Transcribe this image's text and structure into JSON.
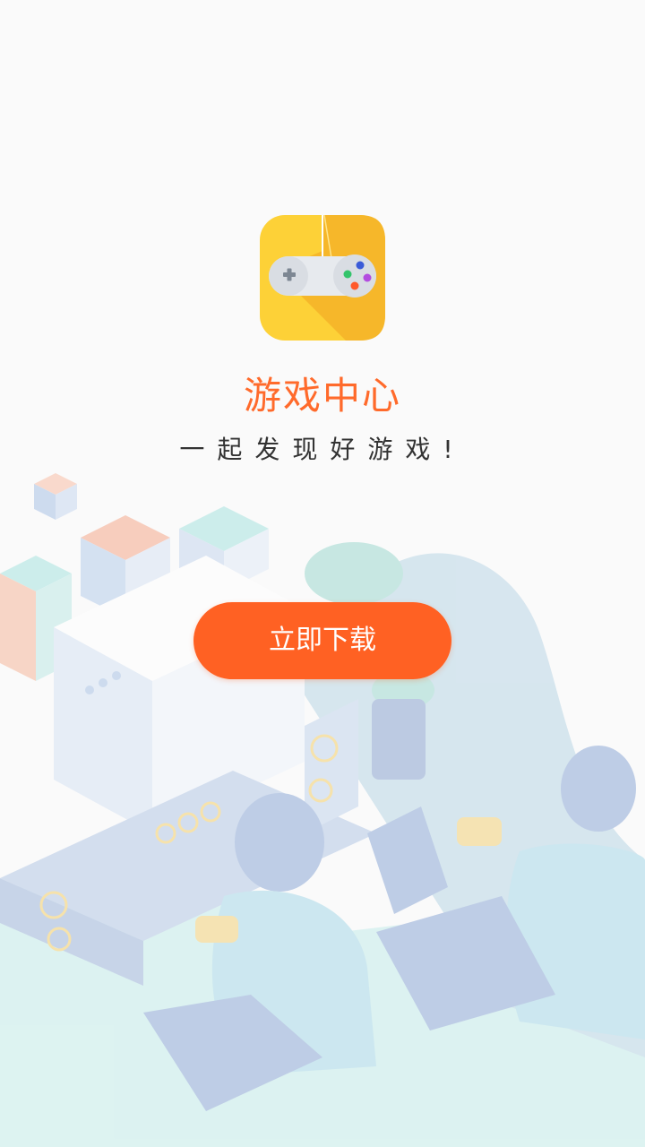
{
  "app": {
    "title": "游戏中心",
    "slogan": "一起发现好游戏!",
    "logo_icon": "gamepad-icon"
  },
  "actions": {
    "download_label": "立即下载"
  },
  "colors": {
    "accent": "#ff6123",
    "title": "#ff6a2b",
    "logo_bg": "#fdd137",
    "background": "#fafafa"
  }
}
